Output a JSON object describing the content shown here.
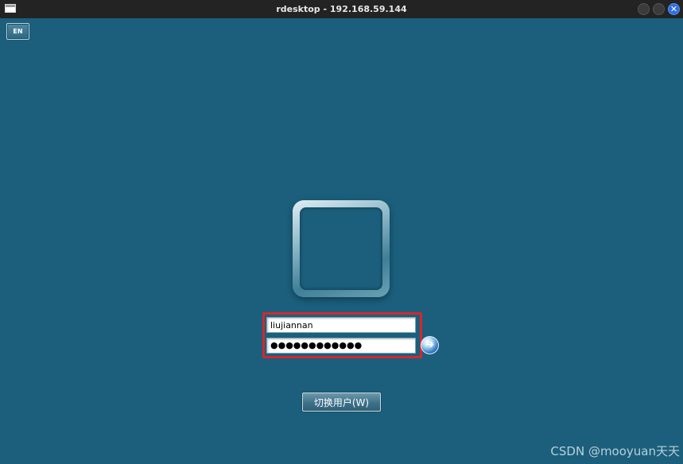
{
  "window": {
    "title": "rdesktop - 192.168.59.144"
  },
  "toolbar": {
    "language_label": "EN"
  },
  "login": {
    "username_value": "liujiannan",
    "password_masked": "●●●●●●●●●●●●",
    "submit_icon": "arrow-right-icon"
  },
  "switch_user": {
    "label": "切换用户(W)"
  },
  "watermark": {
    "text": "CSDN @mooyuan天天"
  },
  "colors": {
    "background": "#1b5f7c",
    "highlight": "#d8262a",
    "titlebar": "#232323"
  }
}
